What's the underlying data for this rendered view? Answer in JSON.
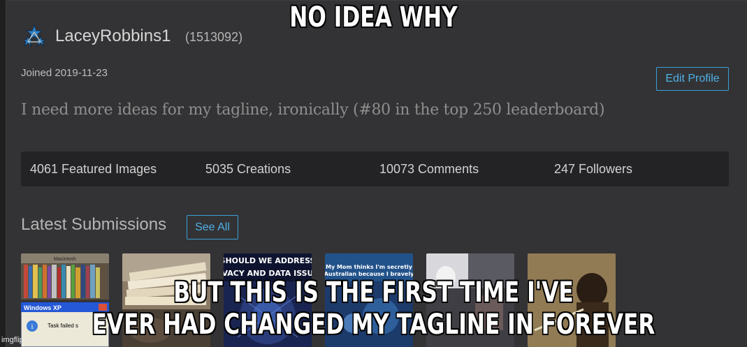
{
  "profile": {
    "username": "LaceyRobbins1",
    "user_id": "(1513092)",
    "joined": "Joined 2019-11-23",
    "edit_label": "Edit Profile",
    "tagline": "I need more ideas for my tagline, ironically (#80 in the top 250 leaderboard)"
  },
  "stats": {
    "featured": "4061 Featured Images",
    "creations": "5035 Creations",
    "comments": "10073 Comments",
    "followers": "247 Followers"
  },
  "submissions": {
    "title": "Latest Submissions",
    "see_all_label": "See All",
    "thumb3_text": "SHOULD WE ADDRESS VACY AND DATA ISSU",
    "thumb4_text": "My Mom thinks I'm secretly Australian because I bravely",
    "thumb1_dialog_title": "Windows XP",
    "thumb1_dialog_text": "Task failed s",
    "thumb1_sign": "Macintosh"
  },
  "meme": {
    "top_text": "NO IDEA WHY",
    "bottom_line1": "BUT THIS IS THE FIRST TIME I'VE",
    "bottom_line2": "EVER HAD CHANGED MY TAGLINE IN FOREVER",
    "watermark": "imgflip.com"
  },
  "colors": {
    "accent": "#4fb0e6",
    "panel_bg": "#333335",
    "stats_bg": "#232325"
  }
}
